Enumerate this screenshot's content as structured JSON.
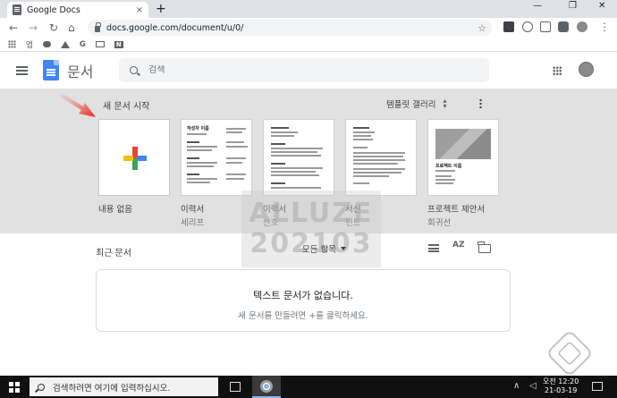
{
  "browser": {
    "tab_title": "Google Docs",
    "tab_close": "×",
    "new_tab": "+",
    "back": "←",
    "forward": "→",
    "reload": "↻",
    "home": "⌂",
    "url": "docs.google.com/document/u/0/",
    "star": "☆",
    "window_controls": [
      "—",
      "❐",
      "✕"
    ]
  },
  "bookmarks": [
    "앱",
    "",
    "",
    "G",
    "",
    "N"
  ],
  "docs": {
    "app_name": "문서",
    "search_placeholder": "검색"
  },
  "templates": {
    "section_title": "새 문서 시작",
    "gallery_label": "템플릿 갤러리",
    "items": [
      {
        "name": "내용 없음",
        "sub": ""
      },
      {
        "name": "이력서",
        "sub": "세리프"
      },
      {
        "name": "이력서",
        "sub": "산호"
      },
      {
        "name": "서신",
        "sub": "민트"
      },
      {
        "name": "프로젝트 제안서",
        "sub": "회귀선"
      }
    ],
    "thumb_text": {
      "resume_serif_name": "작성자 이름",
      "proposal_title": "프로젝트 이름"
    }
  },
  "recent": {
    "title": "최근 문서",
    "owner_filter": "모든 항목",
    "sort_label": "AZ",
    "empty_head": "텍스트 문서가 없습니다.",
    "empty_sub": "새 문서를 만들려면 +를 클릭하세요."
  },
  "watermark": [
    "ALLUZE",
    "202103"
  ],
  "taskbar": {
    "search_text": "검색하려면 여기에 입력하십시오.",
    "time": "오전 12:20",
    "date": "21-03-19"
  },
  "colors": {
    "google_red": "#ea4335",
    "google_yellow": "#fbbc04",
    "google_green": "#34a853",
    "google_blue": "#4285f4",
    "arrow_red": "#e8231c"
  }
}
